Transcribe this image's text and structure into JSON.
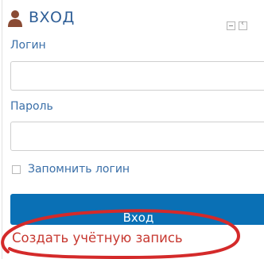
{
  "login_block": {
    "title": "ВХОД",
    "username_label": "Логин",
    "username_value": "",
    "password_label": "Пароль",
    "password_value": "",
    "remember_label": "Запомнить логин",
    "remember_checked": false,
    "submit_label": "Вход",
    "create_account_link": "Создать учётную запись"
  },
  "icons": {
    "header": "user-icon",
    "controls": [
      "minimize-icon",
      "dock-icon"
    ]
  },
  "colors": {
    "accent_blue": "#2f5f97",
    "button_blue": "#0a70b5",
    "link_red": "#c73830",
    "annotation_red": "#d42a2a",
    "user_icon_brown": "#8a4b34"
  }
}
